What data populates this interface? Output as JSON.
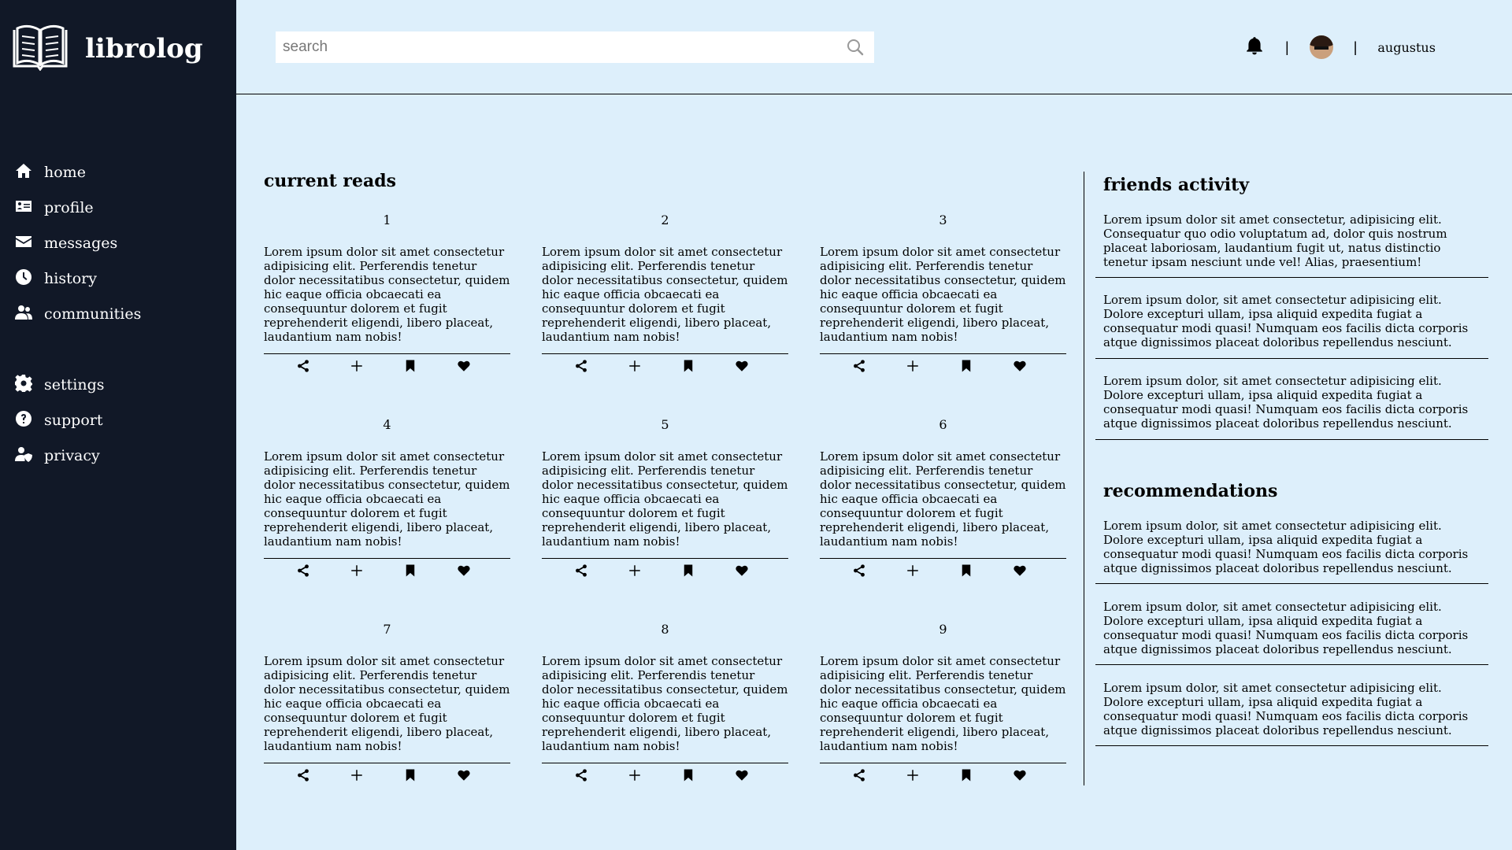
{
  "brand": {
    "name": "librolog",
    "logo_icon": "open-book-icon"
  },
  "nav": {
    "primary": [
      {
        "label": "home",
        "icon": "home-icon"
      },
      {
        "label": "profile",
        "icon": "id-card-icon"
      },
      {
        "label": "messages",
        "icon": "envelope-icon"
      },
      {
        "label": "history",
        "icon": "clock-icon"
      },
      {
        "label": "communities",
        "icon": "users-icon"
      }
    ],
    "secondary": [
      {
        "label": "settings",
        "icon": "gear-icon"
      },
      {
        "label": "support",
        "icon": "question-circle-icon"
      },
      {
        "label": "privacy",
        "icon": "user-shield-icon"
      }
    ]
  },
  "header": {
    "search_placeholder": "search",
    "divider": "|",
    "username": "augustus"
  },
  "current_reads": {
    "title": "current reads",
    "cards": [
      {
        "number": "1",
        "text": "Lorem ipsum dolor sit amet consectetur adipisicing elit. Perferendis tenetur dolor necessitatibus consectetur, quidem hic eaque officia obcaecati ea consequuntur dolorem et fugit reprehenderit eligendi, libero placeat, laudantium nam nobis!"
      },
      {
        "number": "2",
        "text": "Lorem ipsum dolor sit amet consectetur adipisicing elit. Perferendis tenetur dolor necessitatibus consectetur, quidem hic eaque officia obcaecati ea consequuntur dolorem et fugit reprehenderit eligendi, libero placeat, laudantium nam nobis!"
      },
      {
        "number": "3",
        "text": "Lorem ipsum dolor sit amet consectetur adipisicing elit. Perferendis tenetur dolor necessitatibus consectetur, quidem hic eaque officia obcaecati ea consequuntur dolorem et fugit reprehenderit eligendi, libero placeat, laudantium nam nobis!"
      },
      {
        "number": "4",
        "text": "Lorem ipsum dolor sit amet consectetur adipisicing elit. Perferendis tenetur dolor necessitatibus consectetur, quidem hic eaque officia obcaecati ea consequuntur dolorem et fugit reprehenderit eligendi, libero placeat, laudantium nam nobis!"
      },
      {
        "number": "5",
        "text": "Lorem ipsum dolor sit amet consectetur adipisicing elit. Perferendis tenetur dolor necessitatibus consectetur, quidem hic eaque officia obcaecati ea consequuntur dolorem et fugit reprehenderit eligendi, libero placeat, laudantium nam nobis!"
      },
      {
        "number": "6",
        "text": "Lorem ipsum dolor sit amet consectetur adipisicing elit. Perferendis tenetur dolor necessitatibus consectetur, quidem hic eaque officia obcaecati ea consequuntur dolorem et fugit reprehenderit eligendi, libero placeat, laudantium nam nobis!"
      },
      {
        "number": "7",
        "text": "Lorem ipsum dolor sit amet consectetur adipisicing elit. Perferendis tenetur dolor necessitatibus consectetur, quidem hic eaque officia obcaecati ea consequuntur dolorem et fugit reprehenderit eligendi, libero placeat, laudantium nam nobis!"
      },
      {
        "number": "8",
        "text": "Lorem ipsum dolor sit amet consectetur adipisicing elit. Perferendis tenetur dolor necessitatibus consectetur, quidem hic eaque officia obcaecati ea consequuntur dolorem et fugit reprehenderit eligendi, libero placeat, laudantium nam nobis!"
      },
      {
        "number": "9",
        "text": "Lorem ipsum dolor sit amet consectetur adipisicing elit. Perferendis tenetur dolor necessitatibus consectetur, quidem hic eaque officia obcaecati ea consequuntur dolorem et fugit reprehenderit eligendi, libero placeat, laudantium nam nobis!"
      }
    ],
    "card_actions": [
      "share-icon",
      "plus-icon",
      "bookmark-icon",
      "heart-icon"
    ]
  },
  "friends_activity": {
    "title": "friends activity",
    "items": [
      "Lorem ipsum dolor sit amet consectetur, adipisicing elit. Consequatur quo odio voluptatum ad, dolor quis nostrum placeat laboriosam, laudantium fugit ut, natus distinctio tenetur ipsam nesciunt unde vel! Alias, praesentium!",
      "Lorem ipsum dolor, sit amet consectetur adipisicing elit. Dolore excepturi ullam, ipsa aliquid expedita fugiat a consequatur modi quasi! Numquam eos facilis dicta corporis atque dignissimos placeat doloribus repellendus nesciunt.",
      "Lorem ipsum dolor, sit amet consectetur adipisicing elit. Dolore excepturi ullam, ipsa aliquid expedita fugiat a consequatur modi quasi! Numquam eos facilis dicta corporis atque dignissimos placeat doloribus repellendus nesciunt."
    ]
  },
  "recommendations": {
    "title": "recommendations",
    "items": [
      "Lorem ipsum dolor, sit amet consectetur adipisicing elit. Dolore excepturi ullam, ipsa aliquid expedita fugiat a consequatur modi quasi! Numquam eos facilis dicta corporis atque dignissimos placeat doloribus repellendus nesciunt.",
      "Lorem ipsum dolor, sit amet consectetur adipisicing elit. Dolore excepturi ullam, ipsa aliquid expedita fugiat a consequatur modi quasi! Numquam eos facilis dicta corporis atque dignissimos placeat doloribus repellendus nesciunt.",
      "Lorem ipsum dolor, sit amet consectetur adipisicing elit. Dolore excepturi ullam, ipsa aliquid expedita fugiat a consequatur modi quasi! Numquam eos facilis dicta corporis atque dignissimos placeat doloribus repellendus nesciunt."
    ]
  },
  "colors": {
    "sidebar_bg": "#111827",
    "page_bg": "#ddeffb",
    "text": "#000000"
  }
}
